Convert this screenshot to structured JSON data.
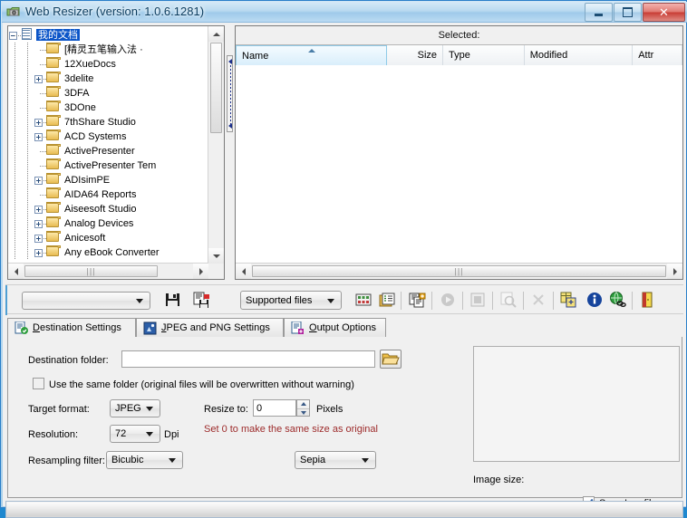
{
  "window": {
    "title": "Web Resizer (version: 1.0.6.1281)",
    "app_icon": "camera-folder-icon",
    "minimize_label": "",
    "maximize_label": "",
    "close_label": "✕",
    "accent_color": "#1f88cf",
    "titlebar_text_color": "#0b3c5e"
  },
  "tree": {
    "items": [
      {
        "label": "我的文档",
        "indent": 1,
        "expander": "minus",
        "icon": "documents-icon",
        "selected": true
      },
      {
        "label": "[精灵五笔输入法 ·",
        "indent": 3,
        "expander": "none",
        "icon": "folder-icon",
        "selected": false
      },
      {
        "label": "12XueDocs",
        "indent": 3,
        "expander": "none",
        "icon": "folder-icon",
        "selected": false
      },
      {
        "label": "3delite",
        "indent": 3,
        "expander": "plus",
        "icon": "folder-icon",
        "selected": false
      },
      {
        "label": "3DFA",
        "indent": 3,
        "expander": "none",
        "icon": "folder-icon",
        "selected": false
      },
      {
        "label": "3DOne",
        "indent": 3,
        "expander": "none",
        "icon": "folder-icon",
        "selected": false
      },
      {
        "label": "7thShare Studio",
        "indent": 3,
        "expander": "plus",
        "icon": "folder-icon",
        "selected": false
      },
      {
        "label": "ACD Systems",
        "indent": 3,
        "expander": "plus",
        "icon": "folder-icon",
        "selected": false
      },
      {
        "label": "ActivePresenter",
        "indent": 3,
        "expander": "none",
        "icon": "folder-icon",
        "selected": false
      },
      {
        "label": "ActivePresenter Tem",
        "indent": 3,
        "expander": "none",
        "icon": "folder-icon",
        "selected": false
      },
      {
        "label": "ADIsimPE",
        "indent": 3,
        "expander": "plus",
        "icon": "folder-icon",
        "selected": false
      },
      {
        "label": "AIDA64 Reports",
        "indent": 3,
        "expander": "none",
        "icon": "folder-icon",
        "selected": false
      },
      {
        "label": "Aiseesoft Studio",
        "indent": 3,
        "expander": "plus",
        "icon": "folder-icon",
        "selected": false
      },
      {
        "label": "Analog Devices",
        "indent": 3,
        "expander": "plus",
        "icon": "folder-icon",
        "selected": false
      },
      {
        "label": "Anicesoft",
        "indent": 3,
        "expander": "plus",
        "icon": "folder-icon",
        "selected": false
      },
      {
        "label": "Any eBook Converter",
        "indent": 3,
        "expander": "plus",
        "icon": "folder-icon",
        "selected": false
      }
    ]
  },
  "file_list": {
    "selected_label": "Selected:",
    "columns": [
      {
        "label": "Name",
        "sorted": true,
        "sort_dir": "asc",
        "align": "left"
      },
      {
        "label": "Size",
        "sorted": false,
        "align": "right"
      },
      {
        "label": "Type",
        "sorted": false,
        "align": "left"
      },
      {
        "label": "Modified",
        "sorted": false,
        "align": "left"
      },
      {
        "label": "Attr",
        "sorted": false,
        "align": "left"
      }
    ],
    "rows": []
  },
  "toolbar": {
    "path_combo_value": "",
    "filter_combo_value": "Supported files",
    "icons": [
      {
        "name": "save-icon",
        "enabled": true
      },
      {
        "name": "save-as-icon",
        "enabled": true
      },
      {
        "name": "thumbnail-grid-icon",
        "enabled": true
      },
      {
        "name": "details-list-icon",
        "enabled": true
      },
      {
        "name": "add-files-icon",
        "enabled": true
      },
      {
        "name": "play-icon",
        "enabled": false
      },
      {
        "name": "stop-icon",
        "enabled": false
      },
      {
        "name": "preview-zoom-icon",
        "enabled": false
      },
      {
        "name": "remove-icon",
        "enabled": false
      },
      {
        "name": "batch-save-icon",
        "enabled": true
      },
      {
        "name": "info-icon",
        "enabled": true
      },
      {
        "name": "web-globe-icon",
        "enabled": true
      },
      {
        "name": "exit-door-icon",
        "enabled": true
      }
    ]
  },
  "tabs": [
    {
      "label": "Destination Settings",
      "accel": "D",
      "icon": "destination-settings-icon",
      "active": true
    },
    {
      "label": "JPEG and PNG Settings",
      "accel": "J",
      "icon": "jpeg-png-settings-icon",
      "active": false
    },
    {
      "label": "Output Options",
      "accel": "O",
      "icon": "output-options-icon",
      "active": false
    }
  ],
  "destination_settings": {
    "destination_folder_label": "Destination folder:",
    "destination_folder_value": "",
    "browse_icon": "open-folder-icon",
    "same_folder_label": "Use the same folder (original files will be overwritten without warning)",
    "same_folder_checked": false,
    "target_format_label": "Target format:",
    "target_format_value": "JPEG",
    "resolution_label": "Resolution:",
    "resolution_value": "72",
    "resolution_unit": "Dpi",
    "resampling_label": "Resampling filter:",
    "resampling_value": "Bicubic",
    "resize_to_label": "Resize to:",
    "resize_to_value": "0",
    "resize_unit": "Pixels",
    "resize_hint": "Set 0 to make the same size as original",
    "effect_value": "Sepia",
    "hint_color": "#9d2b2b"
  },
  "preview": {
    "image_size_label": "Image size:",
    "save_log_label": "Save Log file",
    "save_log_checked": true
  },
  "status_bar": {
    "text": ""
  }
}
